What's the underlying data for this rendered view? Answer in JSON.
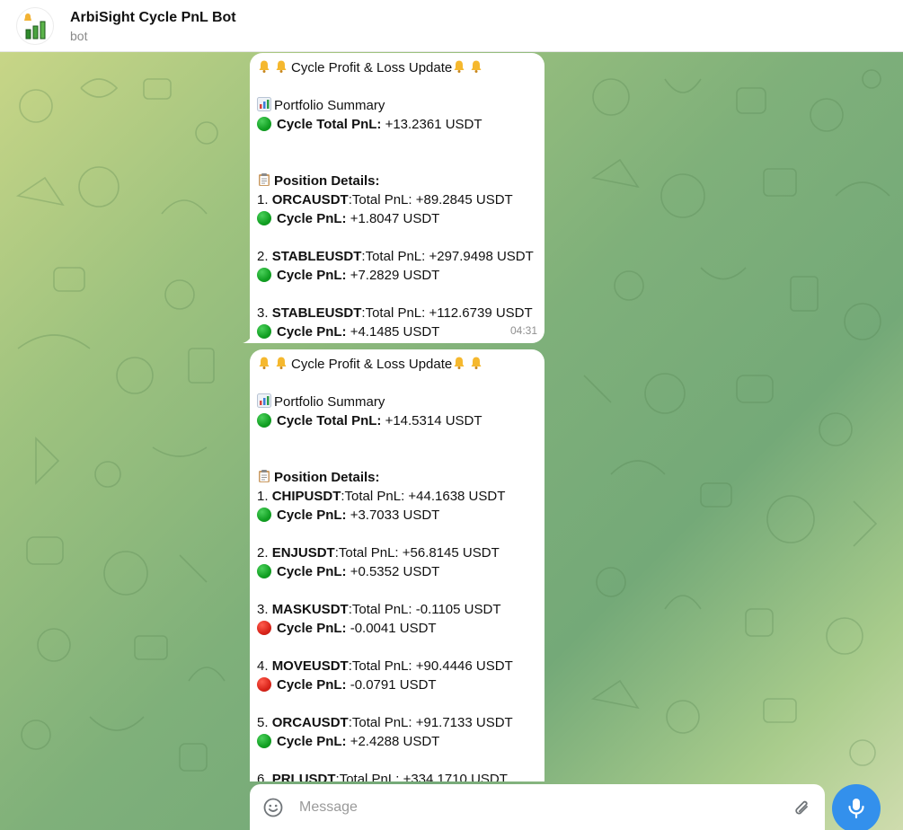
{
  "header": {
    "title": "ArbiSight Cycle PnL Bot",
    "subtitle": "bot"
  },
  "messages": [
    {
      "heading": "Cycle Profit & Loss Update",
      "summary_title": "Portfolio Summary",
      "cycle_total_label": "Cycle Total PnL:",
      "cycle_total_value": " +13.2361 USDT",
      "details_title": "Position Details:",
      "positions": [
        {
          "index": "1. ",
          "symbol": "ORCAUSDT",
          "total": ":Total PnL: +89.2845 USDT",
          "cycle_label": "Cycle PnL:",
          "cycle_value": " +1.8047 USDT",
          "status": "green"
        },
        {
          "index": "2. ",
          "symbol": "STABLEUSDT",
          "total": ":Total PnL: +297.9498 USDT",
          "cycle_label": "Cycle PnL:",
          "cycle_value": " +7.2829 USDT",
          "status": "green"
        },
        {
          "index": "3. ",
          "symbol": "STABLEUSDT",
          "total": ":Total PnL: +112.6739 USDT",
          "cycle_label": "Cycle PnL:",
          "cycle_value": " +4.1485 USDT",
          "status": "green"
        }
      ],
      "time": "04:31"
    },
    {
      "heading": "Cycle Profit & Loss Update",
      "summary_title": "Portfolio Summary",
      "cycle_total_label": "Cycle Total PnL:",
      "cycle_total_value": " +14.5314 USDT",
      "details_title": "Position Details:",
      "positions": [
        {
          "index": "1. ",
          "symbol": "CHIPUSDT",
          "total": ":Total PnL: +44.1638 USDT",
          "cycle_label": "Cycle PnL:",
          "cycle_value": " +3.7033 USDT",
          "status": "green"
        },
        {
          "index": "2. ",
          "symbol": "ENJUSDT",
          "total": ":Total PnL: +56.8145 USDT",
          "cycle_label": "Cycle PnL:",
          "cycle_value": " +0.5352 USDT",
          "status": "green"
        },
        {
          "index": "3. ",
          "symbol": "MASKUSDT",
          "total": ":Total PnL: -0.1105 USDT",
          "cycle_label": "Cycle PnL:",
          "cycle_value": " -0.0041 USDT",
          "status": "red"
        },
        {
          "index": "4. ",
          "symbol": "MOVEUSDT",
          "total": ":Total PnL: +90.4446 USDT",
          "cycle_label": "Cycle PnL:",
          "cycle_value": " -0.0791 USDT",
          "status": "red"
        },
        {
          "index": "5. ",
          "symbol": "ORCAUSDT",
          "total": ":Total PnL: +91.7133 USDT",
          "cycle_label": "Cycle PnL:",
          "cycle_value": " +2.4288 USDT",
          "status": "green"
        },
        {
          "index": "6. ",
          "symbol": "PRLUSDT",
          "total": ":Total PnL: +334.1710 USDT"
        }
      ]
    }
  ],
  "composer": {
    "placeholder": "Message"
  },
  "icons": {
    "avatar": "bar-chart-bell-icon",
    "heading": "bell-icon",
    "summary": "bar-chart-icon",
    "details": "clipboard-icon",
    "emoji": "smile-icon",
    "attach": "paperclip-icon",
    "send": "microphone-icon"
  },
  "colors": {
    "accent": "#3390ec",
    "positive": "#12a023",
    "negative": "#d9241a"
  }
}
